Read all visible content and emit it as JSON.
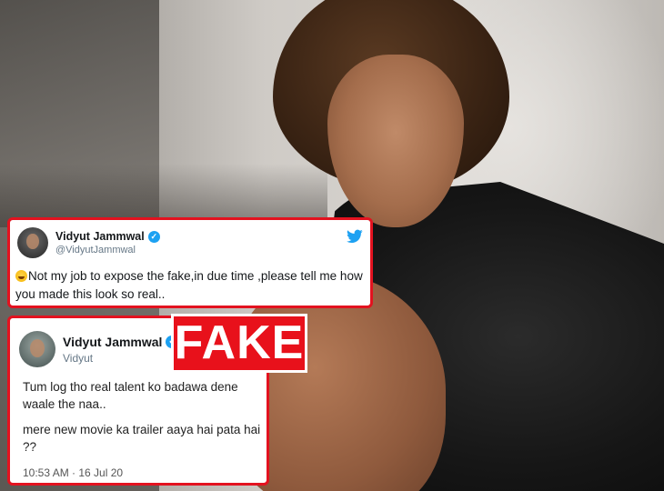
{
  "tweet_real": {
    "name": "Vidyut Jammwal",
    "handle": "@VidyutJammwal",
    "text": "Not my job to expose the fake,in due time ,please tell me how you made this look so real..",
    "emoji": "face-with-tears-of-joy",
    "verified_icon": "verified-badge-icon",
    "platform_icon": "twitter-bird-icon"
  },
  "tweet_fake": {
    "name": "Vidyut Jammwal",
    "handle": "Vidyut",
    "line1": "Tum log tho real talent ko badawa dene waale the naa..",
    "line2": "mere new movie ka trailer aaya hai pata hai ??",
    "timestamp": "10:53 AM · 16 Jul 20"
  },
  "stamp": {
    "label": "FAKE"
  },
  "colors": {
    "highlight_border": "#e3121f",
    "stamp_background": "#e8111b",
    "verified_blue": "#1da1f2"
  }
}
